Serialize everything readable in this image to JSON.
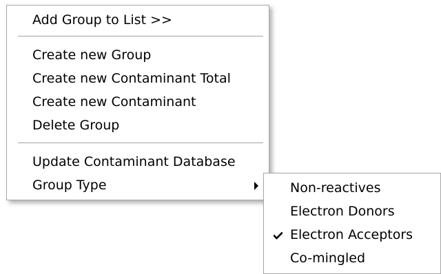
{
  "main_menu": {
    "items": [
      {
        "label": "Add Group to List >>"
      },
      {
        "label": "Create new Group"
      },
      {
        "label": "Create new Contaminant Total"
      },
      {
        "label": "Create new Contaminant"
      },
      {
        "label": "Delete Group"
      },
      {
        "label": "Update Contaminant Database"
      },
      {
        "label": "Group Type",
        "submenu_arrow_icon": "triangle-right-icon"
      }
    ]
  },
  "sub_menu": {
    "items": [
      {
        "label": "Non-reactives",
        "checked": false
      },
      {
        "label": "Electron Donors",
        "checked": false
      },
      {
        "label": "Electron Acceptors",
        "checked": true,
        "check_icon": "checkmark-icon"
      },
      {
        "label": "Co-mingled",
        "checked": false
      }
    ]
  },
  "colors": {
    "menu_background": "#ffffff",
    "menu_border": "#a6a6a6",
    "separator": "#a0a0a0",
    "text": "#000000"
  }
}
